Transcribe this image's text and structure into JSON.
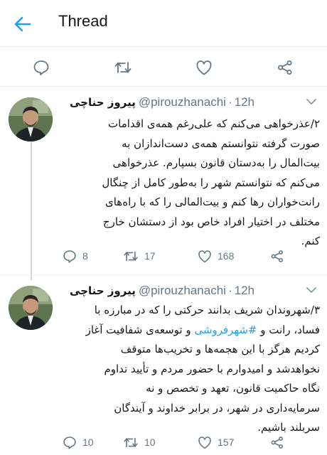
{
  "header": {
    "title": "Thread",
    "back_icon": "back-arrow-icon"
  },
  "top_actions": [
    "reply-icon",
    "retweet-icon",
    "like-icon",
    "share-icon"
  ],
  "colors": {
    "accent": "#1da1f2",
    "muted": "#657786",
    "text": "#14171a",
    "divider": "#e6ecf0"
  },
  "tweets": [
    {
      "name": "پیروز حناچی",
      "handle": "@pirouzhanachi",
      "separator": "·",
      "time": "12h",
      "lines": [
        "۲/عذرخواهی می‌کنم که علی‌رغم همه‌ی اقدامات",
        "صورت گرفته نتوانستم همه‌ی دست‌اندازان به",
        "بیت‌المال را به‌دستان قانون بسپارم. عذرخواهی",
        "می‌کنم که نتوانستم شهر را به‌طور کامل از چنگال",
        "رانت‌خواران رها کنم و بیت‌المالی را که با راه‌های",
        "مختلف در اختیار افراد خاص بود از دستشان خارج",
        "کنم."
      ],
      "replies": "8",
      "retweets": "17",
      "likes": "168"
    },
    {
      "name": "پیروز حناچی",
      "handle": "@pirouzhanachi",
      "separator": "·",
      "time": "12h",
      "lines": [
        "۳/شهروندان شریف بدانند حرکتی را که در مبارزه با",
        "فساد، رانت و #شهرفروشی و توسعه‌ی شفافیت آغاز",
        "کردیم هرگز با این هجمه‌ها و تخریب‌ها متوقف",
        "نخواهدشد و امیدوارم با حضور مردم و تأیید تداوم",
        "نگاه حاکمیت قانون، تعهد و تخصص و نه",
        "سرمایه‌داری در شهر، در برابر خداوند و آیندگان",
        "سربلند باشیم."
      ],
      "hashtag": "#شهرفروشی",
      "line2_before": "فساد، رانت و ",
      "line2_after": " و توسعه‌ی شفافیت آغاز",
      "replies": "10",
      "retweets": "10",
      "likes": "157"
    }
  ]
}
